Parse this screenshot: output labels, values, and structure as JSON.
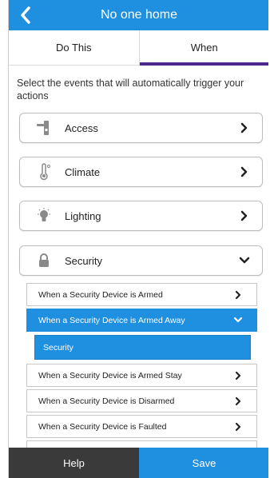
{
  "header": {
    "title": "No one home",
    "back_icon": "chevron-left-icon"
  },
  "tabs": [
    {
      "label": "Do This",
      "active": false
    },
    {
      "label": "When",
      "active": true
    }
  ],
  "instruction": "Select the events that will automatically trigger your actions",
  "categories": [
    {
      "label": "Access",
      "icon": "door-lock-icon",
      "expanded": false
    },
    {
      "label": "Climate",
      "icon": "thermometer-icon",
      "expanded": false
    },
    {
      "label": "Lighting",
      "icon": "light-bulb-icon",
      "expanded": false
    },
    {
      "label": "Security",
      "icon": "padlock-icon",
      "expanded": true
    }
  ],
  "security_events": [
    {
      "label": "When a Security Device is Armed",
      "selected": false
    },
    {
      "label": "When a Security Device is Armed Away",
      "selected": true
    },
    {
      "label": "When a Security Device is Armed Stay",
      "selected": false
    },
    {
      "label": "When a Security Device is Disarmed",
      "selected": false
    },
    {
      "label": "When a Security Device is Faulted",
      "selected": false
    }
  ],
  "selected_device": "Security",
  "footer": {
    "help_label": "Help",
    "save_label": "Save"
  },
  "colors": {
    "accent": "#1f8fe0",
    "tab_indicator": "#4b2a8c",
    "help_bg": "#3a3a3a"
  }
}
